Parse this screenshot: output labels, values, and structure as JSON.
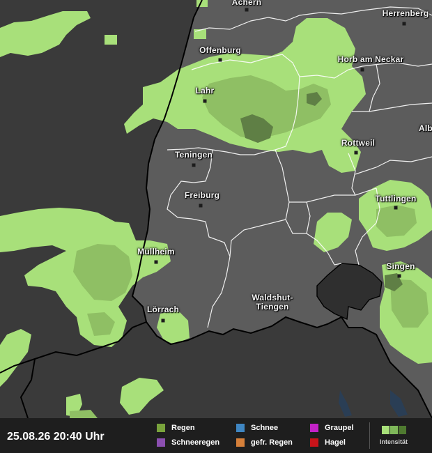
{
  "map": {
    "cities": [
      {
        "name": "Achern"
      },
      {
        "name": "Herrenberg"
      },
      {
        "name": "Offenburg"
      },
      {
        "name": "Horb am Neckar"
      },
      {
        "name": "Lahr"
      },
      {
        "name": "Alb"
      },
      {
        "name": "Rottweil"
      },
      {
        "name": "Teningen"
      },
      {
        "name": "Freiburg"
      },
      {
        "name": "Tuttlingen"
      },
      {
        "name": "Müllheim"
      },
      {
        "name": "Singen"
      },
      {
        "name": "Waldshut-\nTiengen"
      },
      {
        "name": "Lörrach"
      }
    ],
    "colors": {
      "background": "#3a3a3a",
      "region": "#5c5c5c",
      "rain_light": "#a8e07a",
      "rain_mid": "#8fbf64",
      "rain_dark": "#5f7f45",
      "border": "#000000",
      "district": "#ffffff",
      "switzerland_enclave": "#2f2f2f"
    }
  },
  "footer": {
    "timestamp": "25.08.26 20:40 Uhr",
    "legend": [
      {
        "label": "Regen",
        "color": "#79a33c"
      },
      {
        "label": "Schneeregen",
        "color": "#8b4fb0"
      },
      {
        "label": "Schnee",
        "color": "#3f86c2"
      },
      {
        "label": "gefr. Regen",
        "color": "#d6803a"
      },
      {
        "label": "Graupel",
        "color": "#c422c8"
      },
      {
        "label": "Hagel",
        "color": "#c8141a"
      }
    ],
    "intensity_label": "Intensität",
    "intensity_colors": [
      "#a8e07a",
      "#7fb85a",
      "#4f7a30"
    ]
  }
}
